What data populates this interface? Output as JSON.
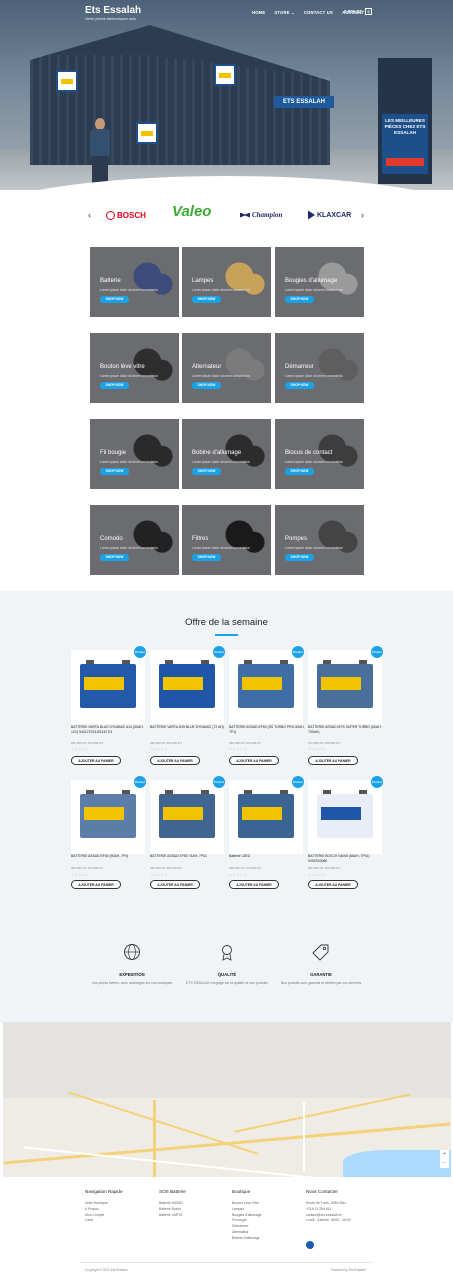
{
  "header": {
    "brand": "Ets Essalah",
    "tagline": "Vente pieces électroniques auto",
    "menu": [
      "HOME",
      "STORE",
      "CONTACT US",
      "ACCOUNT"
    ],
    "store_chevron": "⌄",
    "cart_total": "0,000 DT",
    "cart_count": "0"
  },
  "hero_signage": {
    "store_sign": "ETS ESSALAH",
    "pylon_text": "LES MEILLEURES PIÈCES CHEZ ETS ESSALAH"
  },
  "brands": {
    "prev": "‹",
    "next": "›",
    "items": [
      "BOSCH",
      "Valeo",
      "Champion",
      "KLAXCAR"
    ]
  },
  "categories": {
    "shop_label": "SHOP NOW",
    "description": "Lorem ipsum dolor sit amet consectetur.",
    "items": [
      {
        "title": "Batterie"
      },
      {
        "title": "Lampes"
      },
      {
        "title": "Bougies d'allumage"
      },
      {
        "title": "Bouton lève vitre"
      },
      {
        "title": "Alternateur"
      },
      {
        "title": "Démarreur"
      },
      {
        "title": "Fil bougie"
      },
      {
        "title": "Bobine d'allumage"
      },
      {
        "title": "Blocus de contact"
      },
      {
        "title": "Comodo"
      },
      {
        "title": "Filtres"
      },
      {
        "title": "Pompes"
      }
    ]
  },
  "offer": {
    "title": "Offre de la semaine",
    "badge": "Promo!",
    "add_to_cart": "AJOUTER AU PANIER",
    "stars": "☆☆☆☆☆",
    "products": [
      {
        "name": "BATTERIE VARTA BLUE DYNAMIC A14 (60AH-12V) 540127033-B3132 E3",
        "price": "265,000 DT 215,000 DT"
      },
      {
        "name": "BATTERIE VARTA D39 BLUE DYNAMIC (72 AH)",
        "price": "295,000 DT 230,000 DT"
      },
      {
        "name": "BATTERIE ASSAD EF60 (SS TURBO PRO 60AH, 7P1)",
        "price": "250,000 DT 220,000 DT"
      },
      {
        "name": "BATTERIE ASSAD MTS SUPER TURBO (60AH, 700AH)",
        "price": "270,000 DT 245,000 DT"
      },
      {
        "name": "BATTERIE ASSAD EF60 (90AH, 7P4)",
        "price": "305,000 DT 270,000 DT"
      },
      {
        "name": "BATTERIE ASSAD EF60 74AH, 7P41",
        "price": "290,000 DT 255,000 DT"
      },
      {
        "name": "Batterie L3ED",
        "price": "300,000 DT 270,000 DT"
      },
      {
        "name": "BATTERIE BOSCH S4008 (66AH, 7P41) 0092S40080",
        "price": "330,000 DT 300,000 DT"
      }
    ]
  },
  "features": [
    {
      "title": "EXPEDITION",
      "desc": "Vos pièces livrées, avec avantages sur nos boutiques"
    },
    {
      "title": "QUALITÉ",
      "desc": "ETS ESSALAH s'engage sur la qualité de ses produits"
    },
    {
      "title": "GARANTIE",
      "desc": "Nos produits sont garantis et vérifiés par nos services"
    }
  ],
  "footer": {
    "col1": {
      "title": "Navigation Rapide",
      "items": [
        "Notre Boutique",
        "A Propos",
        "Mon Compte",
        "Carte"
      ]
    },
    "col2": {
      "title": "SOS Batterie",
      "items": [
        "Batterie ASSAD",
        "Batterie Bosch",
        "Batterie VARTA"
      ]
    },
    "col3": {
      "title": "Boutique",
      "items": [
        "Bouton Lève Vitre",
        "Lampes",
        "Bougies d'allumage",
        "Fil bougie",
        "Démarreur",
        "Alternateur",
        "Bobine d'allumage"
      ]
    },
    "col4": {
      "title": "Nous Contacter",
      "items": [
        "Route de Tunis, 3054 Sfax",
        "+216 74 254 611",
        "contact@ets-essalah.tn",
        "Lundi - Samedi: 08:00 - 18:00"
      ]
    },
    "copyright": "Copyright © 2022 Ets Essalah",
    "powered": "Powered by Ets Essalah"
  },
  "colors": {
    "accent": "#1ba2e6",
    "hero": "#5d7288",
    "offer_bg": "#f1f4f6"
  }
}
